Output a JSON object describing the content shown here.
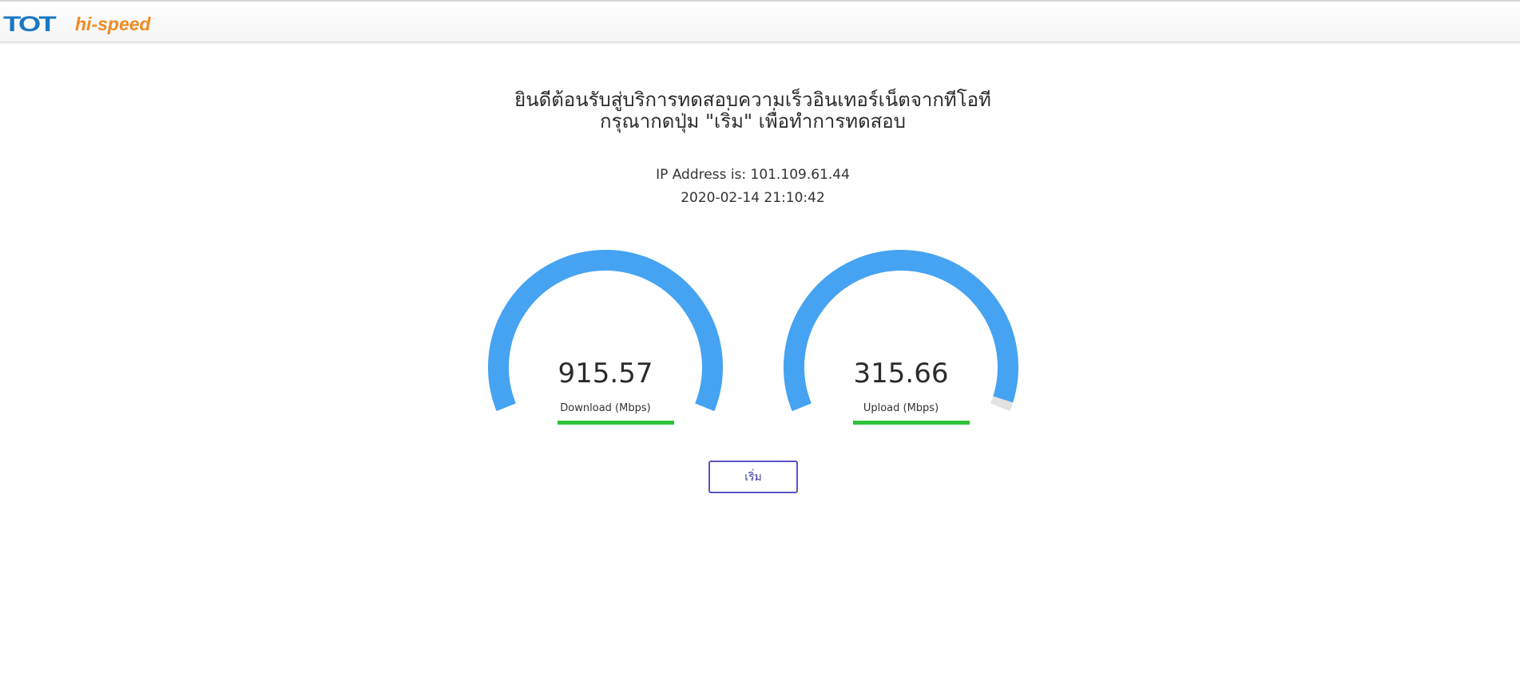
{
  "header": {
    "logo_tot": "TOT",
    "logo_hispeed": "hi-speed",
    "colors": {
      "tot": "#1a78c2",
      "hispeed": "#f18a21"
    }
  },
  "welcome": {
    "line1": "ยินดีต้อนรับสู่บริการทดสอบความเร็วอินเทอร์เน็ตจากทีโอที",
    "line2": "กรุณากดปุ่ม \"เริ่ม\" เพื่อทำการทดสอบ"
  },
  "info": {
    "ip_line": "IP Address is: 101.109.61.44",
    "datetime": "2020-02-14 21:10:42"
  },
  "gauges": [
    {
      "id": "download",
      "value": "915.57",
      "label": "Download (Mbps)",
      "fill_fraction": 1.0
    },
    {
      "id": "upload",
      "value": "315.66",
      "label": "Upload (Mbps)",
      "fill_fraction": 0.98
    }
  ],
  "colors": {
    "gauge_fill": "#45a3f2",
    "gauge_track": "#e2e2e2",
    "bar": "#2fc23a",
    "button_border": "#5a54c7"
  },
  "start_button": {
    "label": "เริ่ม"
  }
}
